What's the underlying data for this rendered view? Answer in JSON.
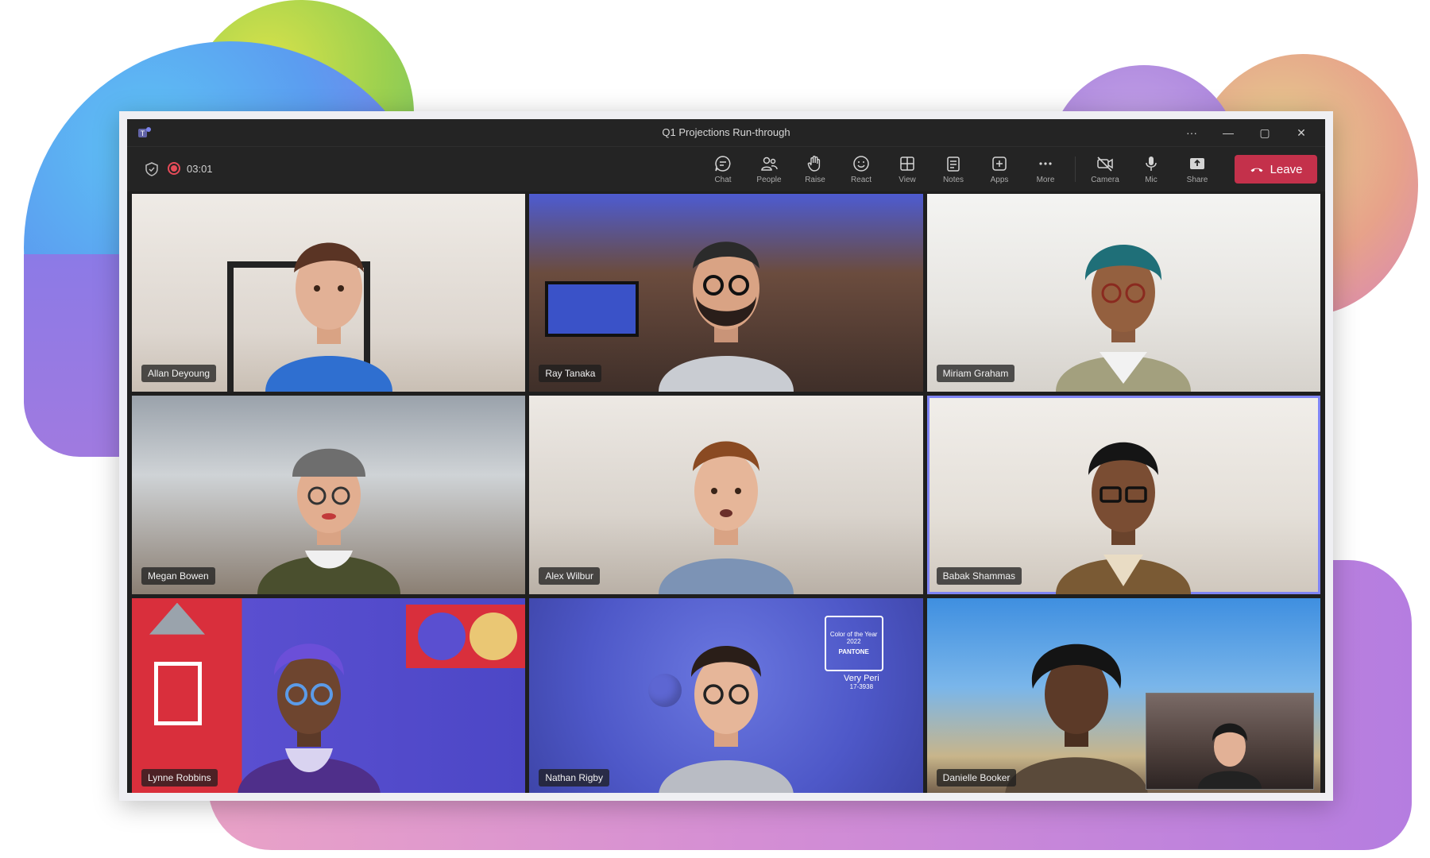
{
  "window": {
    "title": "Q1 Projections Run-through"
  },
  "toolbar": {
    "timer": "03:01",
    "tools": [
      {
        "label": "Chat",
        "icon": "chat-icon"
      },
      {
        "label": "People",
        "icon": "people-icon"
      },
      {
        "label": "Raise",
        "icon": "raise-hand-icon"
      },
      {
        "label": "React",
        "icon": "react-icon"
      },
      {
        "label": "View",
        "icon": "view-icon"
      },
      {
        "label": "Notes",
        "icon": "notes-icon"
      },
      {
        "label": "Apps",
        "icon": "apps-icon"
      },
      {
        "label": "More",
        "icon": "more-icon"
      },
      {
        "label": "Camera",
        "icon": "camera-off-icon"
      },
      {
        "label": "Mic",
        "icon": "mic-icon"
      },
      {
        "label": "Share",
        "icon": "share-icon"
      }
    ],
    "leave_label": "Leave"
  },
  "participants": [
    {
      "name": "Allan Deyoung"
    },
    {
      "name": "Ray Tanaka"
    },
    {
      "name": "Miriam Graham"
    },
    {
      "name": "Megan Bowen"
    },
    {
      "name": "Alex Wilbur"
    },
    {
      "name": "Babak Shammas"
    },
    {
      "name": "Lynne Robbins"
    },
    {
      "name": "Nathan Rigby"
    },
    {
      "name": "Danielle Booker"
    }
  ],
  "pantone": {
    "line1": "Color of the Year 2022",
    "brand": "PANTONE",
    "color_name": "Very Peri",
    "code": "17-3938"
  },
  "colors": {
    "leave": "#c4314b",
    "accent": "#7f85f5"
  }
}
